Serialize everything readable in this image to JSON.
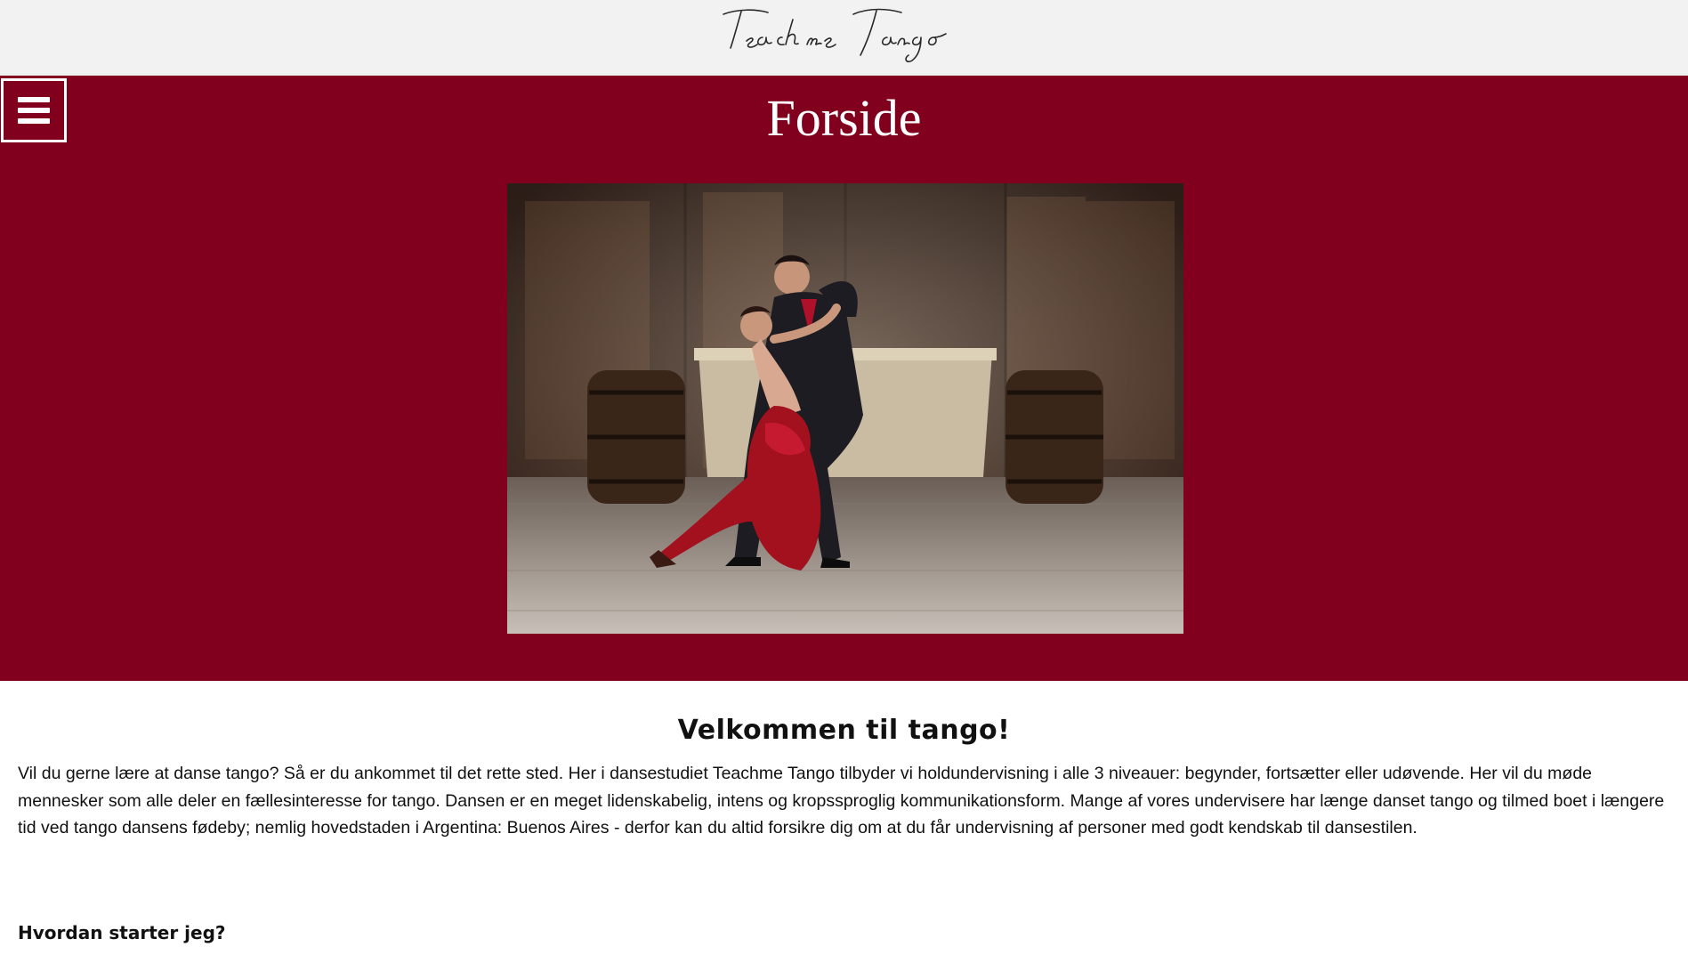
{
  "header": {
    "logo_text": "Teachme Tango"
  },
  "hero": {
    "menu_icon": "hamburger-menu-icon",
    "title": "Forside",
    "background_color": "#80001e"
  },
  "main": {
    "welcome_heading": "Velkommen til tango!",
    "intro_text": "Vil du gerne lære at danse tango? Så er du ankommet til det rette sted. Her i dansestudiet Teachme Tango tilbyder vi holdundervisning i alle 3 niveauer: begynder, fortsætter eller udøvende. Her vil du møde mennesker som alle deler en fællesinteresse for tango. Dansen er en meget lidenskabelig, intens og kropssproglig kommunikationsform. Mange af vores undervisere har længe danset tango og tilmed boet i længere tid ved tango dansens fødeby; nemlig hovedstaden i Argentina: Buenos Aires - derfor kan du altid forsikre dig om at du får undervisning af personer med godt kendskab til dansestilen.",
    "subheading": "Hvordan starter jeg?"
  }
}
